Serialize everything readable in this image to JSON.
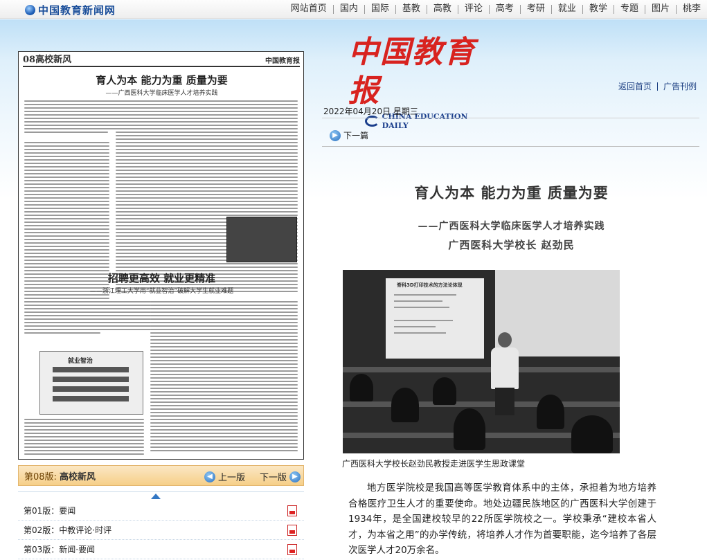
{
  "site": {
    "logo_text": "中国教育新闻网",
    "nav": [
      "网站首页",
      "国内",
      "国际",
      "基教",
      "高教",
      "评论",
      "高考",
      "考研",
      "就业",
      "教学",
      "专题",
      "图片",
      "桃李"
    ]
  },
  "masthead": {
    "cn": "中国教育报",
    "en": "CHINA EDUCATION DAILY"
  },
  "links": {
    "home": "返回首页",
    "ads": "广告刊例"
  },
  "date": "2022年04月20日  星期三",
  "next_article": "下一篇",
  "newspaper_page": {
    "page_no": "08高校新风",
    "masthead": "中国教育报",
    "headline1": "育人为本  能力为重  质量为要",
    "subhead1": "——广西医科大学临床医学人才培养实践",
    "headline2": "招聘更高效  就业更精准",
    "subhead2": "——浙江理工大学用“就业智治”破解大学生就业难题",
    "box_label": "就业智治"
  },
  "current_page": {
    "label": "第08版:",
    "name": "高校新风",
    "prev": "上一版",
    "next": "下一版"
  },
  "page_list": [
    {
      "label": "第01版：要闻"
    },
    {
      "label": "第02版：中教评论·时评"
    },
    {
      "label": "第03版：新闻·要闻"
    }
  ],
  "article": {
    "title": "育人为本  能力为重  质量为要",
    "subtitle": "——广西医科大学临床医学人才培养实践",
    "author": "广西医科大学校长  赵劲民",
    "photo_screen_title": "脊科3D打印技术的方法论体现",
    "caption": "广西医科大学校长赵劲民教授走进医学生思政课堂",
    "paragraph": "地方医学院校是我国高等医学教育体系中的主体，承担着为地方培养合格医疗卫生人才的重要使命。地处边疆民族地区的广西医科大学创建于1934年，是全国建校较早的22所医学院校之一。学校秉承“建校本省人才，为本省之用”的办学传统，将培养人才作为首要职能，迄今培养了各层次医学人才20万余名。"
  }
}
